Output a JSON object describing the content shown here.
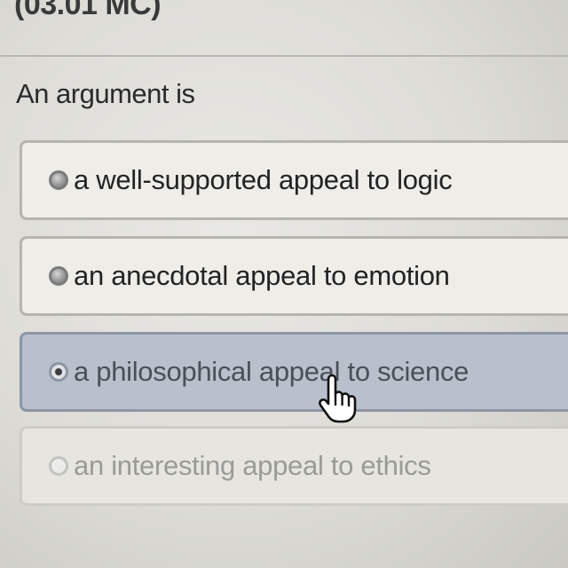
{
  "question": {
    "number": "(03.01 MC)",
    "prompt": "An argument is"
  },
  "options": [
    {
      "label": "a well-supported appeal to logic",
      "selected": false
    },
    {
      "label": "an anecdotal appeal to emotion",
      "selected": false
    },
    {
      "label": "a philosophical appeal to science",
      "selected": true
    },
    {
      "label": "an interesting appeal to ethics",
      "selected": false
    }
  ],
  "cursor": {
    "icon": "hand-pointer-icon"
  }
}
